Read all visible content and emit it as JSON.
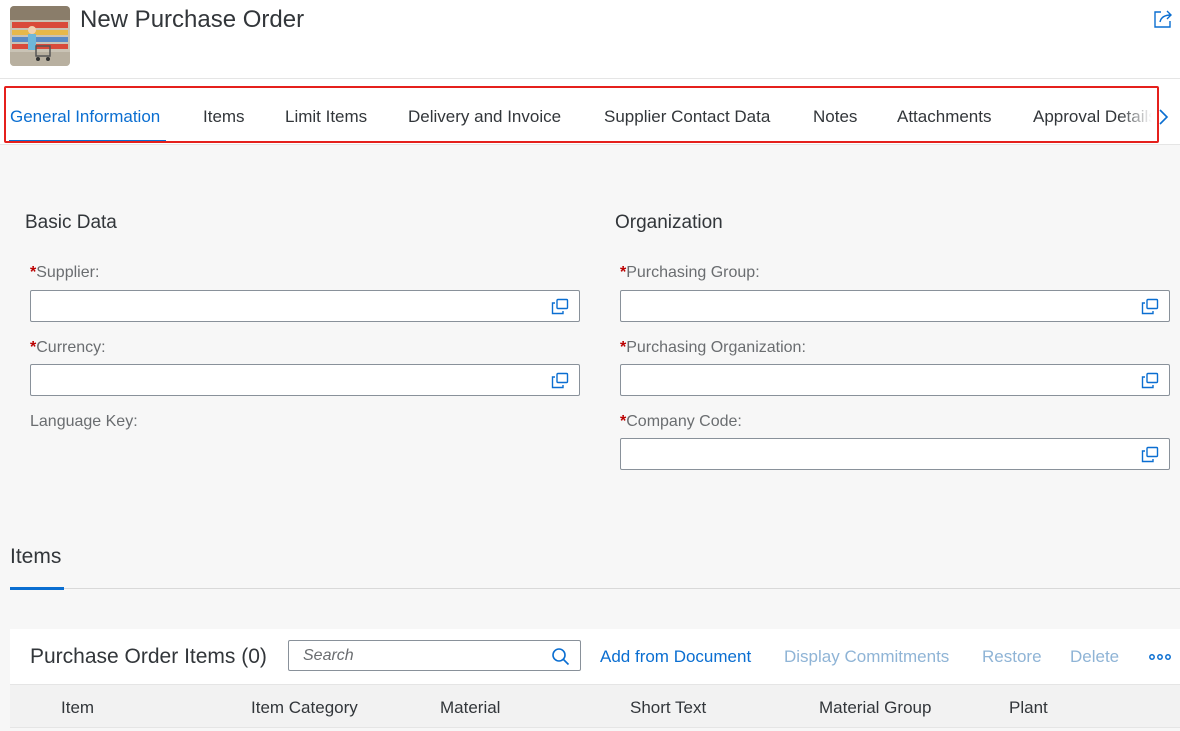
{
  "header": {
    "title": "New Purchase Order"
  },
  "tabs": [
    {
      "label": "General Information",
      "active": true
    },
    {
      "label": "Items"
    },
    {
      "label": "Limit Items"
    },
    {
      "label": "Delivery and Invoice"
    },
    {
      "label": "Supplier Contact Data"
    },
    {
      "label": "Notes"
    },
    {
      "label": "Attachments"
    },
    {
      "label": "Approval Details"
    }
  ],
  "basic_data": {
    "title": "Basic Data",
    "supplier": {
      "label": "Supplier:",
      "required": "*",
      "value": ""
    },
    "currency": {
      "label": "Currency:",
      "required": "*",
      "value": ""
    },
    "language_key": {
      "label": "Language Key:"
    }
  },
  "organization": {
    "title": "Organization",
    "purchasing_group": {
      "label": "Purchasing Group:",
      "required": "*",
      "value": ""
    },
    "purchasing_org": {
      "label": "Purchasing Organization:",
      "required": "*",
      "value": ""
    },
    "company_code": {
      "label": "Company Code:",
      "required": "*",
      "value": ""
    }
  },
  "items_section": {
    "title": "Items"
  },
  "items_table": {
    "title": "Purchase Order Items (0)",
    "search_placeholder": "Search",
    "actions": {
      "add_from_document": "Add from Document",
      "display_commitments": "Display Commitments",
      "restore": "Restore",
      "delete": "Delete"
    },
    "columns": [
      "Item",
      "Item Category",
      "Material",
      "Short Text",
      "Material Group",
      "Plant"
    ]
  },
  "colors": {
    "accent": "#0a6ed1",
    "required": "#bb0000",
    "highlight": "#e5201c"
  },
  "icons": {
    "share": "share-icon",
    "value_help": "value-help-icon",
    "search": "search-icon",
    "overflow": "overflow-icon",
    "tab_scroll": "chevron-right-icon"
  }
}
